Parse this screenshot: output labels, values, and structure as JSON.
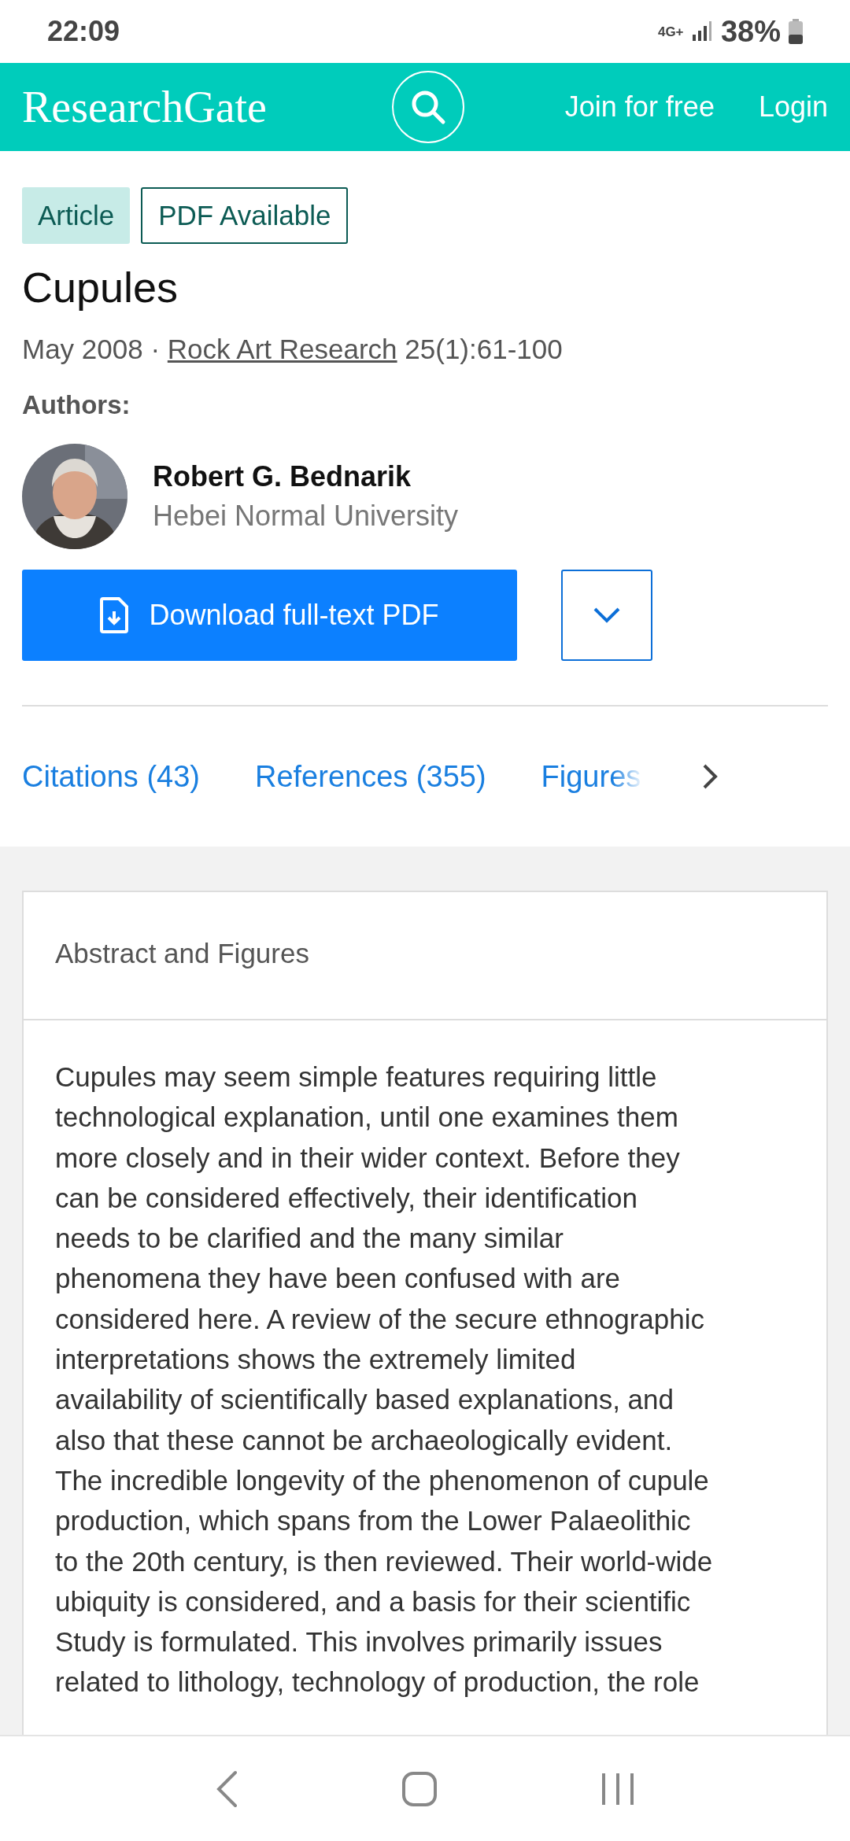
{
  "status_bar": {
    "time": "22:09",
    "network": "4G+",
    "battery": "38%"
  },
  "header": {
    "logo": "ResearchGate",
    "links": [
      "Join for free",
      "Login"
    ]
  },
  "article": {
    "badges": [
      {
        "label": "Article",
        "kind": "filled"
      },
      {
        "label": "PDF Available",
        "kind": "outlined"
      }
    ],
    "title": "Cupules",
    "date": "May 2008 · ",
    "journal": "Rock Art Research",
    "issue": " 25(1):61-100",
    "authors_label": "Authors:",
    "authors": [
      {
        "name": "Robert G. Bednarik",
        "affiliation": "Hebei Normal University"
      }
    ],
    "download_button": "Download full-text PDF"
  },
  "tabs": [
    {
      "label": "Citations (43)",
      "faded": false
    },
    {
      "label": "References (355)",
      "faded": false
    },
    {
      "label": "Figures",
      "faded": true
    }
  ],
  "abstract": {
    "heading": "Abstract and Figures",
    "lines": [
      "Cupules may seem simple features requiring little",
      "technological explanation, until one examines them",
      "more closely and in their wider context. Before they",
      "can be considered effectively, their identification",
      "needs to be clarified and the many similar",
      "phenomena they have been confused with are",
      "considered here. A review of the secure ethnographic",
      "interpretations shows the extremely limited",
      "availability of scientifically based explanations, and",
      "also that these cannot be archaeologically evident.",
      "The incredible longevity of the phenomenon of cupule",
      "production, which spans from the Lower Palaeolithic",
      "to the 20th century, is then reviewed. Their world-wide",
      "ubiquity is considered, and a basis for their scientific",
      "Study is formulated. This involves primarily issues",
      "related to lithology, technology of production, the role"
    ]
  }
}
